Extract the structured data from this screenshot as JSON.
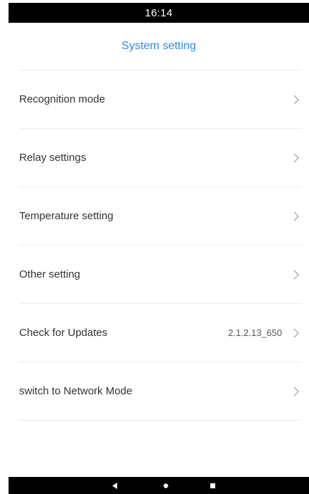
{
  "status_bar": {
    "time": "16:14"
  },
  "header": {
    "title": "System setting"
  },
  "menu": {
    "items": [
      {
        "label": "Recognition mode",
        "value": ""
      },
      {
        "label": "Relay settings",
        "value": ""
      },
      {
        "label": "Temperature setting",
        "value": ""
      },
      {
        "label": "Other setting",
        "value": ""
      },
      {
        "label": "Check for Updates",
        "value": "2.1.2.13_650"
      },
      {
        "label": "switch to Network Mode",
        "value": ""
      }
    ]
  },
  "colors": {
    "accent": "#2f8cf3",
    "status_bar_bg": "#000000",
    "divider": "#ececec",
    "text": "#333333"
  },
  "icons": {
    "chevron": "chevron-right-icon",
    "nav_back": "back-triangle-icon",
    "nav_home": "home-circle-icon",
    "nav_recents": "recents-square-icon"
  }
}
